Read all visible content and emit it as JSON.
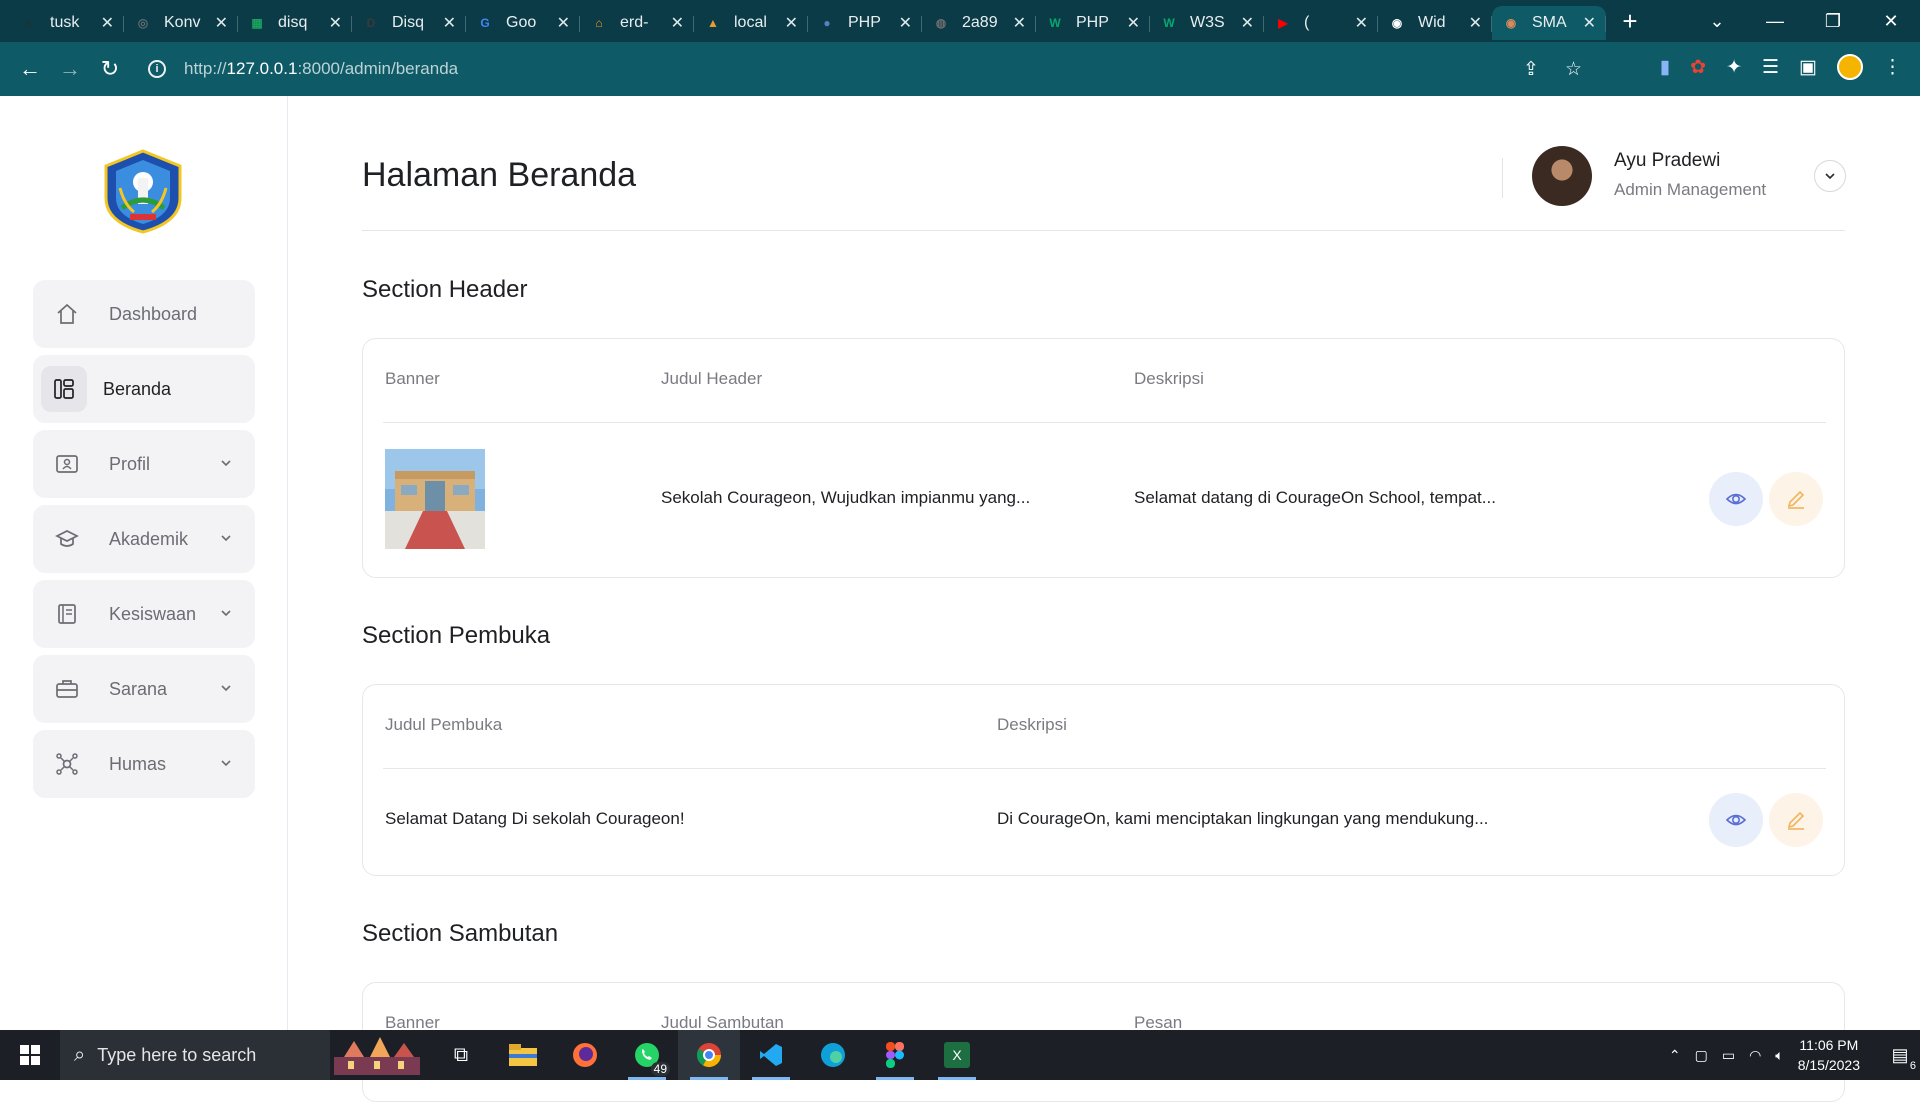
{
  "browser": {
    "tabs": [
      {
        "title": "tusk",
        "color": "#2c2c2c",
        "glyph": "◐"
      },
      {
        "title": "Konv",
        "color": "#5f6b72",
        "glyph": "◎"
      },
      {
        "title": "disq",
        "color": "#1aa260",
        "glyph": "▦"
      },
      {
        "title": "Disq",
        "color": "#3a3a3a",
        "glyph": "D"
      },
      {
        "title": "Goo",
        "color": "#4285f4",
        "glyph": "G"
      },
      {
        "title": "erd-",
        "color": "#f09a1c",
        "glyph": "⌂"
      },
      {
        "title": "local",
        "color": "#e79d2d",
        "glyph": "▲"
      },
      {
        "title": "PHP",
        "color": "#5a7fbf",
        "glyph": "●"
      },
      {
        "title": "2a89",
        "color": "#6c6c6c",
        "glyph": "◍"
      },
      {
        "title": "PHP",
        "color": "#04aa6d",
        "glyph": "W"
      },
      {
        "title": "W3S",
        "color": "#04aa6d",
        "glyph": "W"
      },
      {
        "title": "(",
        "color": "#ff0000",
        "glyph": "▶"
      },
      {
        "title": "Wid",
        "color": "#ffffff",
        "glyph": "◉"
      },
      {
        "title": "SMA",
        "color": "#d98b5c",
        "glyph": "◉"
      }
    ],
    "url_prefix": "http://",
    "url_host": "127.0.0.1",
    "url_path": ":8000/admin/beranda"
  },
  "sidebar": {
    "items": [
      {
        "label": "Dashboard",
        "icon": "home-icon",
        "has_chevron": false
      },
      {
        "label": "Beranda",
        "icon": "layout-icon",
        "has_chevron": false,
        "active": true
      },
      {
        "label": "Profil",
        "icon": "id-card-icon",
        "has_chevron": true
      },
      {
        "label": "Akademik",
        "icon": "graduation-cap-icon",
        "has_chevron": true
      },
      {
        "label": "Kesiswaan",
        "icon": "book-icon",
        "has_chevron": true
      },
      {
        "label": "Sarana",
        "icon": "briefcase-icon",
        "has_chevron": true
      },
      {
        "label": "Humas",
        "icon": "network-icon",
        "has_chevron": true
      }
    ]
  },
  "header": {
    "title": "Halaman Beranda",
    "user_name": "Ayu Pradewi",
    "user_role": "Admin Management"
  },
  "sections": {
    "header": {
      "title": "Section Header",
      "col_banner": "Banner",
      "col_judul": "Judul Header",
      "col_deskripsi": "Deskripsi",
      "row_judul": "Sekolah Courageon, Wujudkan impianmu yang...",
      "row_deskripsi": "Selamat datang di CourageOn School, tempat..."
    },
    "pembuka": {
      "title": "Section Pembuka",
      "col_judul": "Judul Pembuka",
      "col_deskripsi": "Deskripsi",
      "row_judul": "Selamat Datang Di sekolah Courageon!",
      "row_deskripsi": "Di CourageOn, kami menciptakan lingkungan yang mendukung..."
    },
    "sambutan": {
      "title": "Section Sambutan",
      "col_banner": "Banner",
      "col_judul": "Judul Sambutan",
      "col_pesan": "Pesan"
    }
  },
  "taskbar": {
    "search_placeholder": "Type here to search",
    "whatsapp_badge": "49",
    "time": "11:06 PM",
    "date": "8/15/2023",
    "notification_count": "6"
  },
  "colors": {
    "chrome_dark": "#0b3b47",
    "chrome_bar": "#0e5a66",
    "eye_button": "#e9eefb",
    "edit_button": "#fdf4e7",
    "eye_icon": "#5a6fd6",
    "edit_icon": "#f2b35b"
  }
}
